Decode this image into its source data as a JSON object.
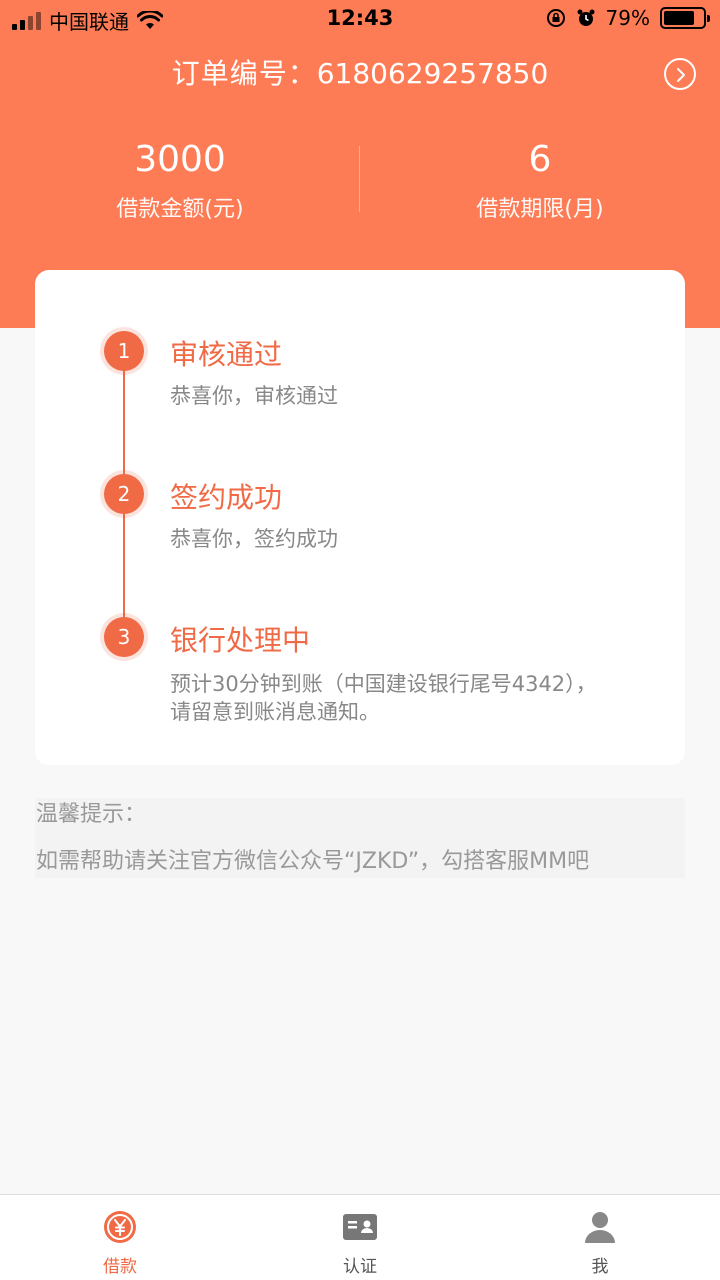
{
  "status_bar": {
    "carrier": "中国联通",
    "time": "12:43",
    "battery_percent": "79%",
    "battery_level": 0.79
  },
  "header": {
    "order_label": "订单编号：",
    "order_number": "6180629257850",
    "amount_value": "3000",
    "amount_label": "借款金额(元)",
    "term_value": "6",
    "term_label": "借款期限(月)",
    "background_color": "#fe7c55"
  },
  "progress": {
    "accent_color": "#f06a46",
    "steps": [
      {
        "number": "1",
        "title": "审核通过",
        "desc": "恭喜你，审核通过"
      },
      {
        "number": "2",
        "title": "签约成功",
        "desc": "恭喜你，签约成功"
      },
      {
        "number": "3",
        "title": "银行处理中",
        "desc": "预计30分钟到账（中国建设银行尾号4342），",
        "desc2": "请留意到账消息通知。"
      }
    ]
  },
  "tips": {
    "title": "温馨提示：",
    "text": "如需帮助请关注官方微信公众号“JZKD”，勾搭客服MM吧"
  },
  "tabbar": {
    "tabs": [
      {
        "label": "借款",
        "icon": "yuan-icon",
        "active": true
      },
      {
        "label": "认证",
        "icon": "id-card-icon",
        "active": false
      },
      {
        "label": "我",
        "icon": "person-icon",
        "active": false
      }
    ]
  }
}
